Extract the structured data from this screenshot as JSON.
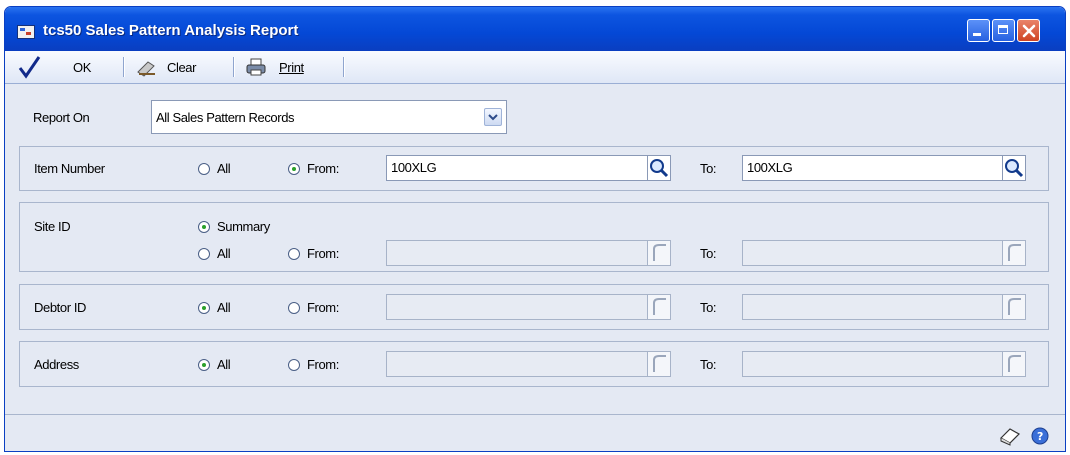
{
  "window": {
    "title": "tcs50 Sales Pattern Analysis Report"
  },
  "toolbar": {
    "ok_label": "OK",
    "clear_label": "Clear",
    "print_label": "Print"
  },
  "report_on": {
    "label": "Report On",
    "selected": "All Sales Pattern Records"
  },
  "item_number": {
    "label": "Item Number",
    "all_label": "All",
    "from_label": "From:",
    "to_label": "To:",
    "from_value": "100XLG",
    "to_value": "100XLG",
    "mode": "from"
  },
  "site_id": {
    "label": "Site ID",
    "summary_label": "Summary",
    "all_label": "All",
    "from_label": "From:",
    "to_label": "To:",
    "mode": "summary"
  },
  "debtor_id": {
    "label": "Debtor ID",
    "all_label": "All",
    "from_label": "From:",
    "to_label": "To:",
    "mode": "all"
  },
  "address": {
    "label": "Address",
    "all_label": "All",
    "from_label": "From:",
    "to_label": "To:",
    "mode": "all"
  },
  "colors": {
    "title_bar": "#0448d6",
    "background": "#e4e9f3",
    "radio_on": "#2aa02a"
  },
  "icons": [
    "checkmark-icon",
    "eraser-icon",
    "printer-icon",
    "lookup-icon",
    "note-icon",
    "help-icon"
  ]
}
